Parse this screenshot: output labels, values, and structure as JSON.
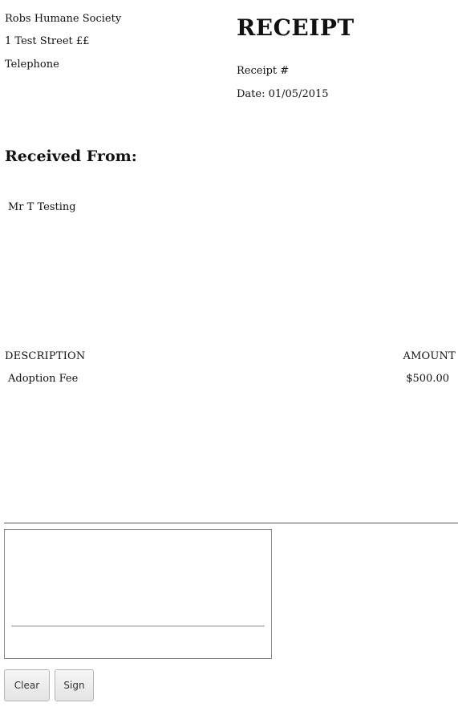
{
  "organization": {
    "name": "Robs Humane Society",
    "address": "1 Test Street ££",
    "telephone": "Telephone"
  },
  "receipt": {
    "title": "RECEIPT",
    "number_label": "Receipt #",
    "date_label": "Date: 01/05/2015"
  },
  "received_from": {
    "heading": "Received From:",
    "name": "Mr T Testing"
  },
  "items_table": {
    "headers": [
      "DESCRIPTION",
      "AMOUNT"
    ],
    "rows": [
      {
        "description": "Adoption Fee",
        "amount": "$500.00"
      }
    ]
  },
  "signature": {
    "clear_label": "Clear",
    "sign_label": "Sign"
  }
}
